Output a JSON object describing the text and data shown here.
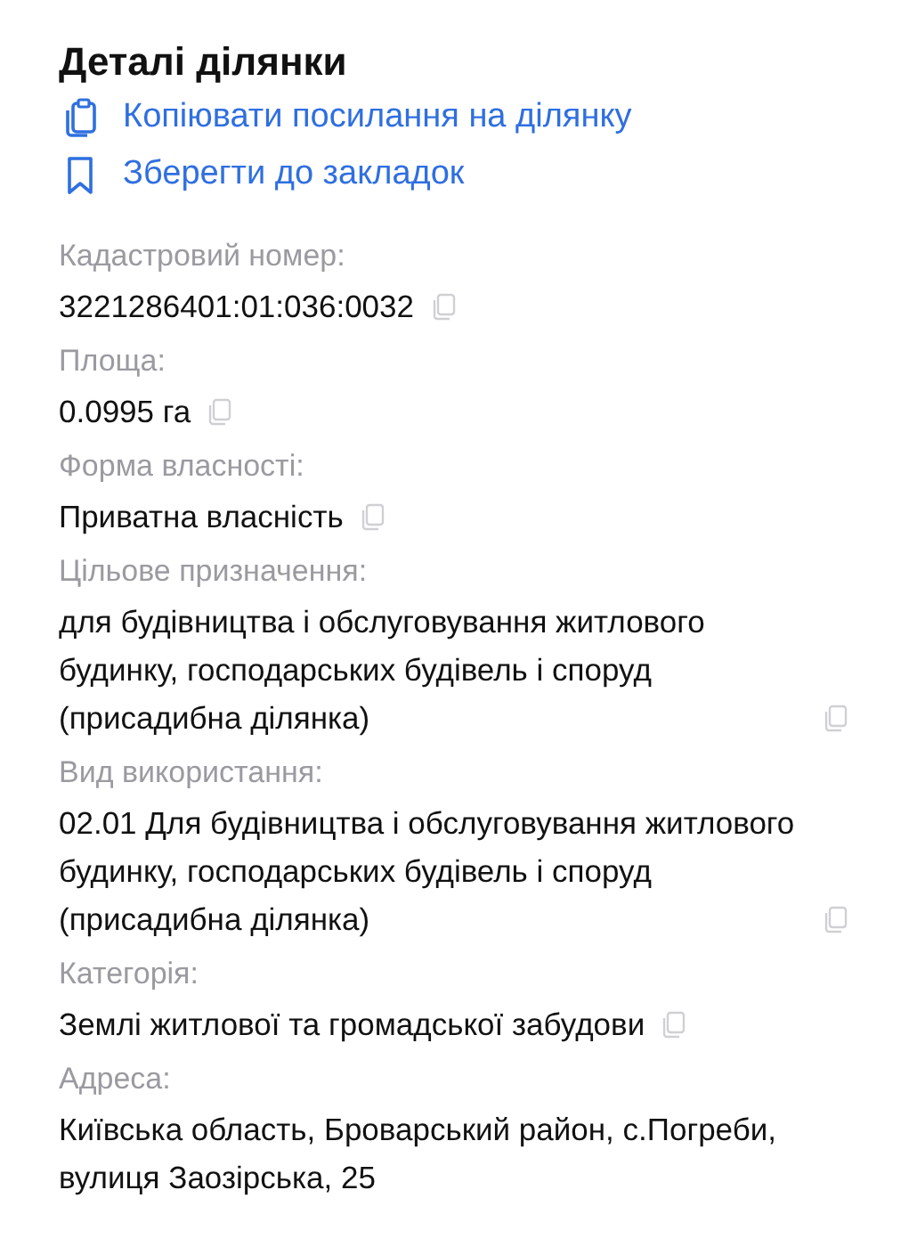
{
  "title": "Деталі ділянки",
  "actions": [
    {
      "kind": "copy",
      "label": "Копіювати посилання на ділянку"
    },
    {
      "kind": "bookmark",
      "label": "Зберегти до закладок"
    }
  ],
  "fields": [
    {
      "label": "Кадастровий номер:",
      "value": "3221286401:01:036:0032",
      "copyable": true
    },
    {
      "label": "Площа:",
      "value": "0.0995 га",
      "copyable": true
    },
    {
      "label": "Форма власності:",
      "value": "Приватна власність",
      "copyable": true
    },
    {
      "label": "Цільове призначення:",
      "value": "для будівництва і обслуговування житлового будинку, господарських будівель і споруд (присадибна ділянка)",
      "copyable": true
    },
    {
      "label": "Вид використання:",
      "value": "02.01 Для будівництва і обслуговування житлового будинку, господарських будівель і споруд (присадибна ділянка)",
      "copyable": true
    },
    {
      "label": "Категорія:",
      "value": "Землі житлової та громадської забудови",
      "copyable": true
    },
    {
      "label": "Адреса:",
      "value": "Київська область, Броварський район, с.Погреби, вулиця Заозірська, 25",
      "copyable": false
    }
  ]
}
